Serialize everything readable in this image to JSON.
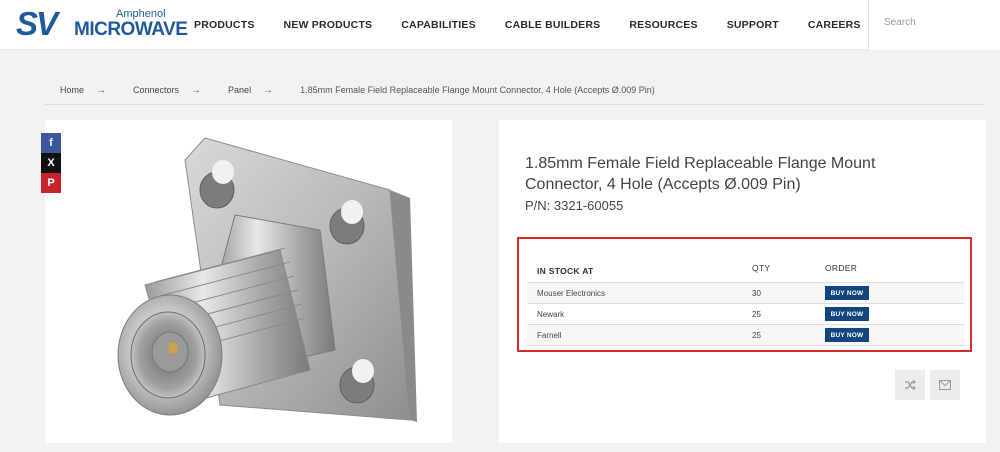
{
  "header": {
    "logo": {
      "sv": "SV",
      "amphenol": "Amphenol",
      "microwave": "MICROWAVE"
    },
    "nav": [
      "PRODUCTS",
      "NEW PRODUCTS",
      "CAPABILITIES",
      "CABLE BUILDERS",
      "RESOURCES",
      "SUPPORT",
      "CAREERS"
    ],
    "search_placeholder": "Search"
  },
  "breadcrumb": {
    "items": [
      "Home",
      "Connectors",
      "Panel"
    ],
    "separator": "→",
    "current": "1.85mm Female Field Replaceable Flange Mount Connector, 4 Hole (Accepts Ø.009 Pin)"
  },
  "share": {
    "facebook": "f",
    "x": "X",
    "pinterest": "P"
  },
  "product": {
    "title": "1.85mm Female Field Replaceable Flange Mount Connector, 4 Hole (Accepts Ø.009 Pin)",
    "part_number": "P/N: 3321-60055"
  },
  "stock": {
    "headers": {
      "distributor": "IN STOCK AT",
      "qty": "QTY",
      "order": "ORDER"
    },
    "rows": [
      {
        "distributor": "Mouser Electronics",
        "qty": "30",
        "button": "BUY NOW"
      },
      {
        "distributor": "Newark",
        "qty": "25",
        "button": "BUY NOW"
      },
      {
        "distributor": "Farnell",
        "qty": "25",
        "button": "BUY NOW"
      }
    ]
  },
  "colors": {
    "brand": "#1f5a9a",
    "buy_button": "#13467f",
    "highlight_border": "#d52b2b"
  },
  "icons": [
    "facebook-icon",
    "x-icon",
    "pinterest-icon",
    "shuffle-icon",
    "mail-icon"
  ]
}
